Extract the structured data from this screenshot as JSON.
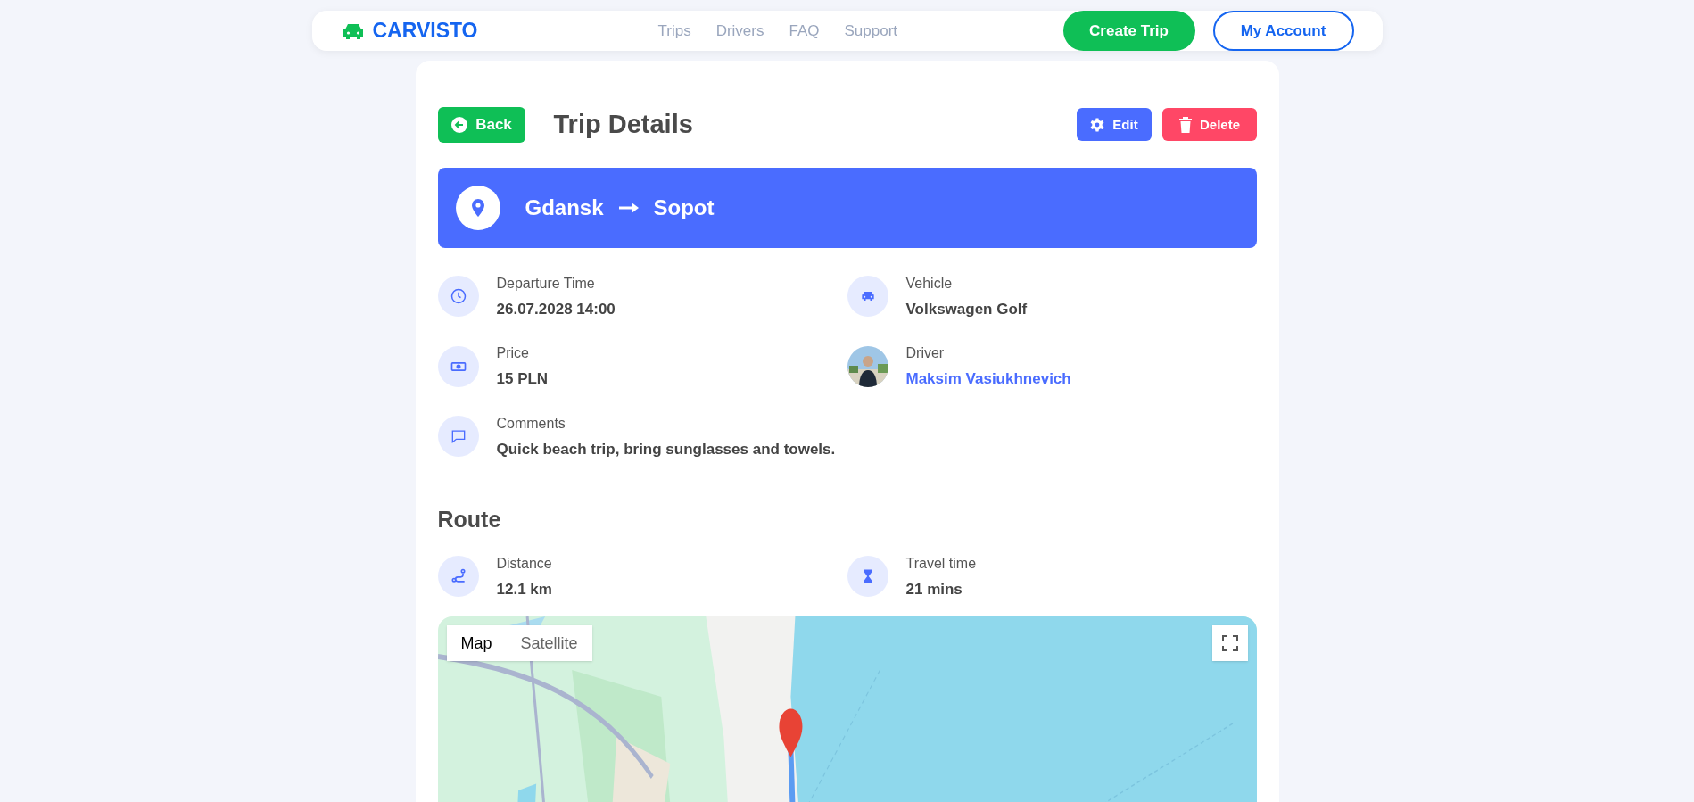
{
  "header": {
    "logo": "CARVISTO",
    "nav": [
      "Trips",
      "Drivers",
      "FAQ",
      "Support"
    ],
    "primary_button": "Create Trip",
    "secondary_button": "My Account"
  },
  "toolbar": {
    "back": "Back",
    "title": "Trip Details",
    "edit": "Edit",
    "delete": "Delete"
  },
  "route_banner": {
    "from": "Gdansk",
    "to": "Sopot"
  },
  "details": [
    {
      "kind": "time",
      "label": "Departure Time",
      "value": "26.07.2028 14:00"
    },
    {
      "kind": "vehicle",
      "label": "Vehicle",
      "value": "Volkswagen Golf"
    },
    {
      "kind": "price",
      "label": "Price",
      "value": "15 PLN"
    },
    {
      "kind": "driver",
      "label": "Driver",
      "value": "Maksim Vasiukhnevich"
    },
    {
      "kind": "comment",
      "label": "Comments",
      "value": "Quick beach trip, bring sunglasses and towels."
    }
  ],
  "route": {
    "heading": "Route",
    "stats": [
      {
        "kind": "distance",
        "label": "Distance",
        "value": "12.1 km"
      },
      {
        "kind": "duration",
        "label": "Travel time",
        "value": "21 mins"
      }
    ]
  },
  "map": {
    "map_types": [
      {
        "label": "Map",
        "selected": true
      },
      {
        "label": "Satellite",
        "selected": false
      }
    ]
  }
}
